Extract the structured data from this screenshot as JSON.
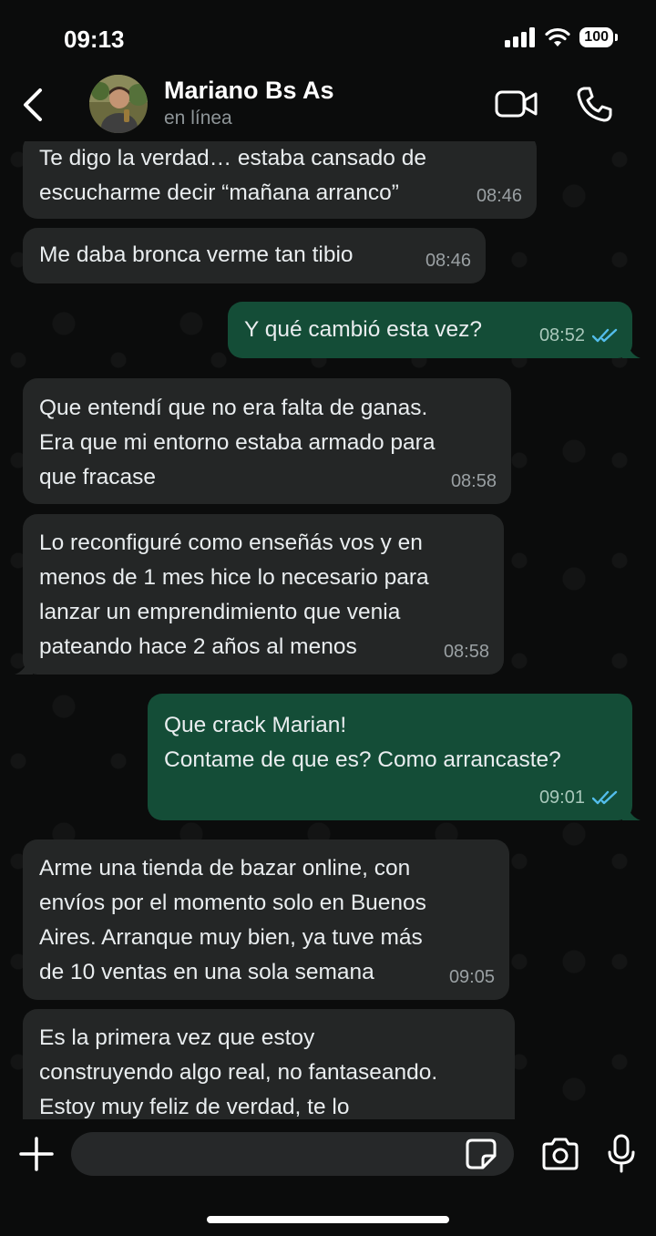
{
  "status_bar": {
    "time": "09:13",
    "battery": "100"
  },
  "header": {
    "contact_name": "Mariano Bs As",
    "contact_status": "en línea"
  },
  "messages": [
    {
      "direction": "in",
      "text": "Te digo la verdad… estaba cansado de\nescucharme decir “mañana arranco”",
      "time": "08:46"
    },
    {
      "direction": "in",
      "text": "Me daba bronca verme tan tibio",
      "time": "08:46"
    },
    {
      "direction": "out",
      "text": "Y qué cambió esta vez?",
      "time": "08:52",
      "read": true
    },
    {
      "direction": "in",
      "text": "Que entendí que no era falta de ganas.\nEra que mi entorno estaba armado para\nque fracase",
      "time": "08:58"
    },
    {
      "direction": "in",
      "text": "Lo reconfiguré como enseñás vos y en\nmenos de 1 mes hice lo necesario para\nlanzar un emprendimiento que venia\npateando hace 2 años al menos",
      "time": "08:58"
    },
    {
      "direction": "out",
      "text": "Que crack Marian!\nContame de que es? Como arrancaste?",
      "time": "09:01",
      "read": true
    },
    {
      "direction": "in",
      "text": "Arme una tienda de bazar online, con\nenvíos por el momento solo en Buenos\nAires. Arranque muy bien, ya tuve más\nde 10 ventas en una sola semana",
      "time": "09:05"
    },
    {
      "direction": "in",
      "text": "Es la primera vez que estoy\nconstruyendo algo real, no fantaseando.\nEstoy muy feliz de verdad, te lo",
      "time": ""
    }
  ],
  "input": {
    "value": "",
    "placeholder": ""
  },
  "colors": {
    "incoming_bubble": "#242626",
    "outgoing_bubble": "#144d37",
    "read_ticks": "#53bdeb",
    "background": "#0b0c0c"
  },
  "icons": [
    "back-icon",
    "video-call-icon",
    "voice-call-icon",
    "plus-icon",
    "sticker-icon",
    "camera-icon",
    "mic-icon",
    "read-ticks-icon"
  ]
}
